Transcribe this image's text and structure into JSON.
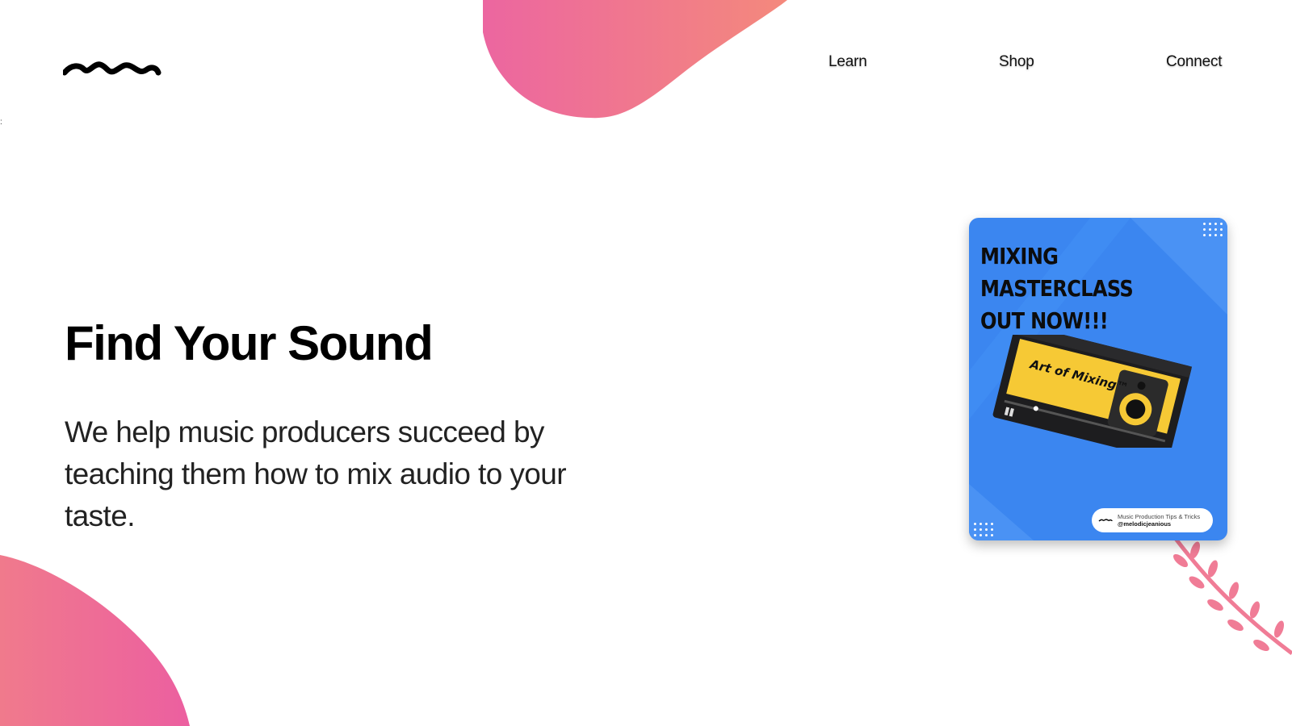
{
  "nav": {
    "items": [
      {
        "label": "Learn"
      },
      {
        "label": "Shop"
      },
      {
        "label": "Connect"
      }
    ]
  },
  "hero": {
    "heading": "Find Your Sound",
    "lead": "We help music producers succeed by teaching them how to mix audio to your taste."
  },
  "promo": {
    "title_lines": [
      "MIXING",
      "MASTERCLASS",
      "OUT NOW!!!"
    ],
    "course_name": "Art of Mixing™",
    "pill_line1": "Music Production Tips & Tricks",
    "pill_line2": "@melodicjeanious"
  },
  "stray_mark": ":",
  "colors": {
    "blob_start": "#f07a8c",
    "blob_end": "#ec5fa0",
    "card_blue": "#3b86f0",
    "accent_yellow": "#f6c935",
    "branch_pink": "#f07c96"
  },
  "icons": {
    "logo": "squiggle-logo-icon",
    "branch": "leaf-branch-icon"
  }
}
